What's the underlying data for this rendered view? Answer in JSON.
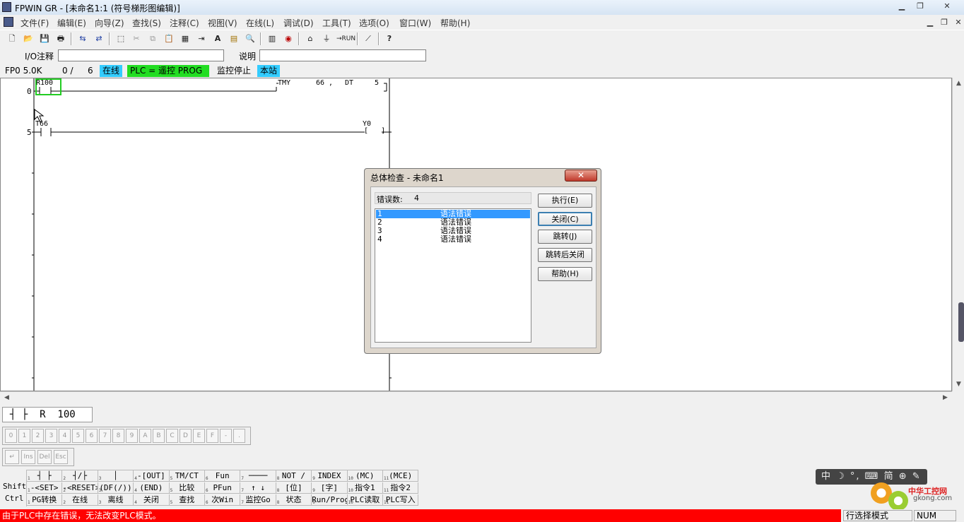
{
  "window": {
    "title": "FPWIN GR - [未命名1:1 (符号梯形图编辑)]"
  },
  "menu": [
    "文件(F)",
    "编辑(E)",
    "向导(Z)",
    "查找(S)",
    "注释(C)",
    "视图(V)",
    "在线(L)",
    "调试(D)",
    "工具(T)",
    "选项(O)",
    "窗口(W)",
    "帮助(H)"
  ],
  "toolbar": {
    "run_label": "→RUN",
    "help_label": "?"
  },
  "comment_bar": {
    "io_label": "I/O注释",
    "io_value": "",
    "desc_label": "说明",
    "desc_value": ""
  },
  "status_line": {
    "model": "FP0 5.0K",
    "steps": "0 /",
    "steps_total": "6",
    "online": "在线",
    "plc_mode": "PLC = 遥控 PROG",
    "monitor": "监控停止",
    "station": "本站"
  },
  "ladder": {
    "rows": [
      {
        "addr": "0",
        "contact": "R100",
        "instr": "TMY",
        "arg1": "66 ,",
        "arg2": "DT",
        "arg3": "5"
      },
      {
        "addr": "5",
        "contact": "T66",
        "coil": "Y0"
      }
    ]
  },
  "dialog": {
    "title": "总体检查 - 未命名1",
    "error_count_label": "错误数:",
    "error_count": "4",
    "buttons": {
      "execute": "执行(E)",
      "close": "关闭(C)",
      "jump": "跳转(J)",
      "jump_close": "跳转后关闭",
      "help": "帮助(H)"
    },
    "errors": [
      {
        "no": "1",
        "msg": "语法错误"
      },
      {
        "no": "2",
        "msg": "语法错误"
      },
      {
        "no": "3",
        "msg": "语法错误"
      },
      {
        "no": "4",
        "msg": "语法错误"
      }
    ]
  },
  "input_bar": {
    "instruction": "┤ ├  R  100"
  },
  "keypad": {
    "digits": [
      "0",
      "1",
      "2",
      "3",
      "4",
      "5",
      "6",
      "7",
      "8",
      "9",
      "A",
      "B",
      "C",
      "D",
      "E",
      "F",
      "-",
      "."
    ],
    "edit_keys": [
      "↵",
      "Ins",
      "Del",
      "Esc"
    ]
  },
  "function_keys": {
    "row_labels": [
      "",
      "Shift",
      "Ctrl"
    ],
    "rows": [
      [
        "┤ ├",
        "┤/├",
        "│",
        "-[OUT]",
        "TM/CT",
        "Fun",
        "────",
        "NOT /",
        "INDEX",
        "(MC)",
        "(MCE)"
      ],
      [
        "-<SET>",
        "-<RESET>",
        "(DF(/))",
        "(END)",
        "比较",
        "PFun",
        "↑ ↓",
        "[位]",
        "[字]",
        "指令1",
        "指令2"
      ],
      [
        "PG转换",
        "在线",
        "离线",
        "关闭",
        "查找",
        "次Win",
        "监控Go",
        "状态",
        "Run/Prog",
        "PLC读取",
        "PLC写入"
      ]
    ]
  },
  "statusbar": {
    "message": "由于PLC中存在错误，无法改变PLC模式。",
    "mode": "行选择模式",
    "num": "NUM"
  },
  "ime": {
    "label": "中 ☽ °, ⌨ 简 ⊕ ✎"
  },
  "watermark": {
    "text": "中华工控网",
    "url": "gkong.com"
  }
}
